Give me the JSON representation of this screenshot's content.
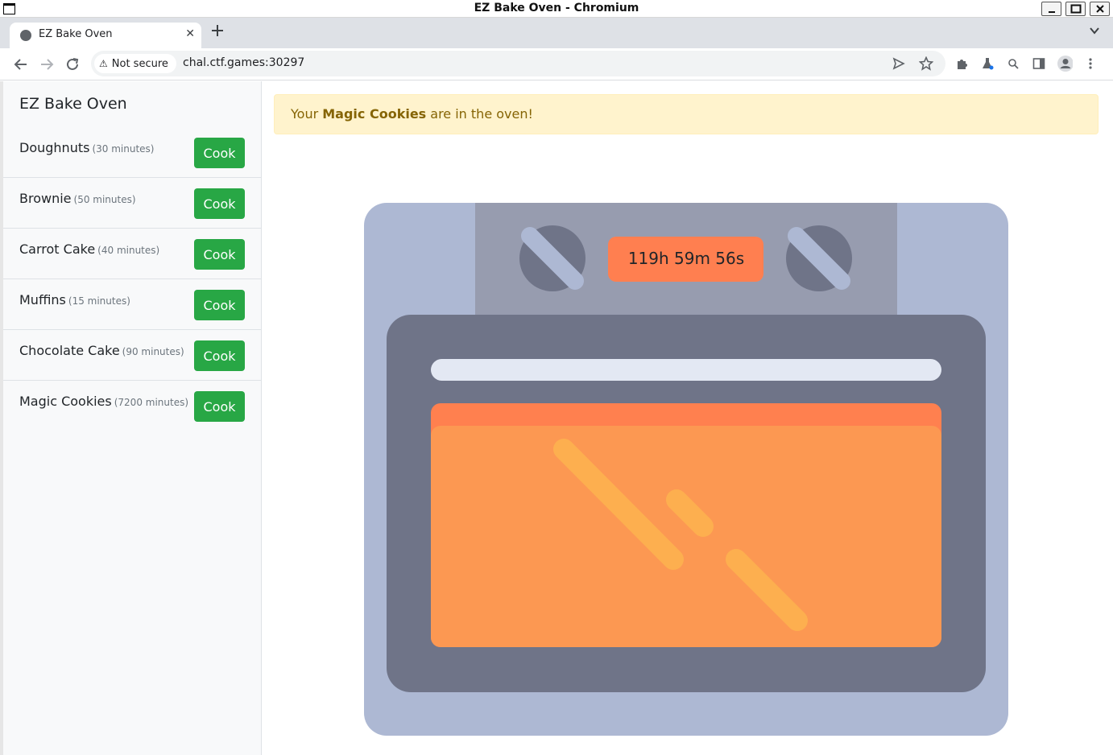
{
  "window": {
    "title": "EZ Bake Oven - Chromium"
  },
  "browser": {
    "tab_title": "EZ Bake Oven",
    "security_label": "Not secure",
    "url": "chal.ctf.games:30297"
  },
  "app": {
    "brand": "EZ Bake Oven",
    "items": [
      {
        "name": "Doughnuts",
        "duration": "(30 minutes)",
        "button": "Cook"
      },
      {
        "name": "Brownie",
        "duration": "(50 minutes)",
        "button": "Cook"
      },
      {
        "name": "Carrot Cake",
        "duration": "(40 minutes)",
        "button": "Cook"
      },
      {
        "name": "Muffins",
        "duration": "(15 minutes)",
        "button": "Cook"
      },
      {
        "name": "Chocolate Cake",
        "duration": "(90 minutes)",
        "button": "Cook"
      },
      {
        "name": "Magic Cookies",
        "duration": "(7200 minutes)",
        "button": "Cook"
      }
    ],
    "alert": {
      "prefix": "Your ",
      "item": "Magic Cookies",
      "suffix": " are in the oven!"
    },
    "timer": "119h 59m 56s"
  },
  "colors": {
    "cook_button": "#28a745",
    "alert_bg": "#fff3cd",
    "timer_bg": "#ff7f50",
    "oven_body": "#adb8d3",
    "oven_panel": "#979caf",
    "oven_door": "#6f7488",
    "window_glass": "#fc9852"
  },
  "icons": [
    "globe-icon",
    "close-icon",
    "plus-icon",
    "back-icon",
    "forward-icon",
    "reload-icon",
    "warning-icon",
    "send-icon",
    "star-icon",
    "extensions-icon",
    "flask-icon",
    "search-icon",
    "sidepanel-icon",
    "profile-icon",
    "menu-icon"
  ]
}
